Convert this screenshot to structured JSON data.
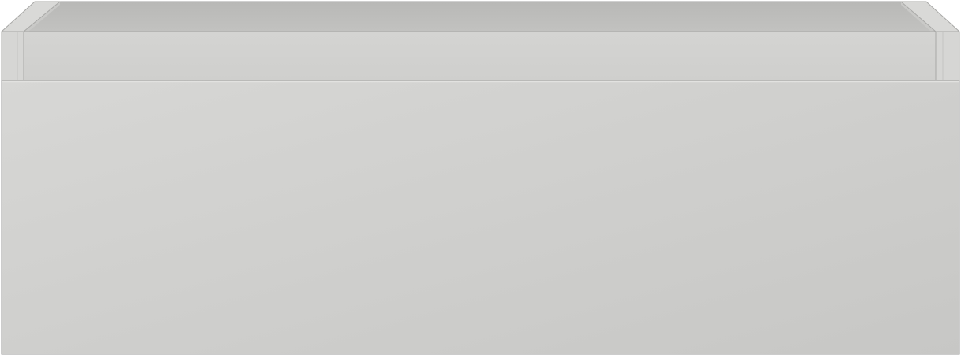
{
  "object": {
    "name": "drawer-box",
    "label": "",
    "colors": {
      "back_panel": "#bcbcbc",
      "top_rail": "#d2d2d0",
      "side_posts": "#d6d6d4",
      "front_panel_light": "#d7d7d5",
      "front_panel_dark": "#c8c8c6",
      "edge_highlight": "#e2e2e0",
      "edge_shadow": "#a8a8a6",
      "outline": "#9a9a98"
    }
  }
}
